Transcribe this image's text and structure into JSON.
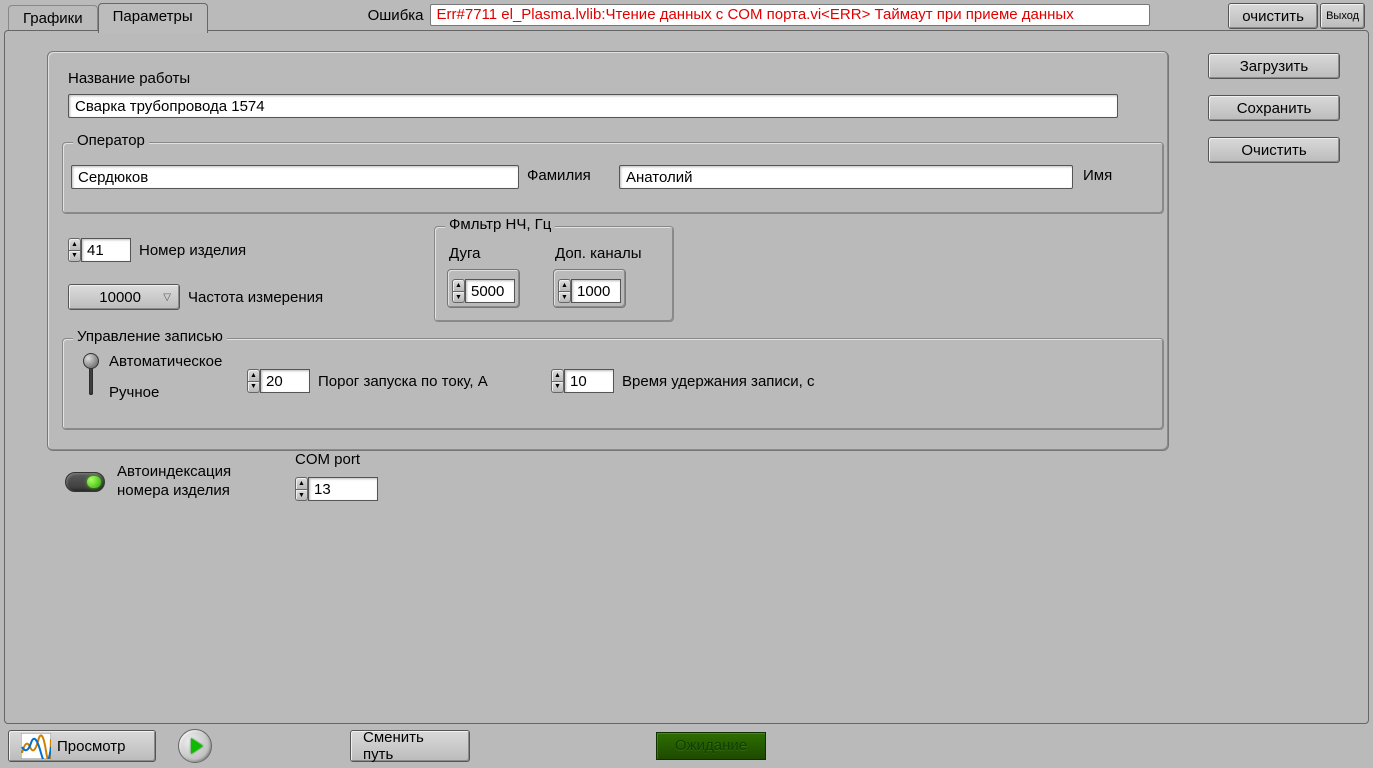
{
  "top": {
    "tab_graphs": "Графики",
    "tab_params": "Параметры",
    "error_label": "Ошибка",
    "error_text": "Err#7711  el_Plasma.lvlib:Чтение данных с COM порта.vi<ERR> Таймаут при приеме данных",
    "btn_clear": "очистить",
    "btn_exit": "Выход"
  },
  "side": {
    "btn_load": "Загрузить",
    "btn_save": "Сохранить",
    "btn_clear": "Очистить"
  },
  "job": {
    "name_label": "Название работы",
    "name_value": "Сварка трубопровода 1574"
  },
  "operator": {
    "legend": "Оператор",
    "lastname_value": "Сердюков",
    "lastname_label": "Фамилия",
    "firstname_value": "Анатолий",
    "firstname_label": "Имя"
  },
  "measure": {
    "product_number": "41",
    "product_number_label": "Номер изделия",
    "frequency": "10000",
    "frequency_label": "Частота измерения"
  },
  "filter": {
    "legend": "Фмльтр НЧ, Гц",
    "arc_label": "Дуга",
    "arc_value": "5000",
    "extra_label": "Доп. каналы",
    "extra_value": "1000"
  },
  "recording": {
    "legend": "Управление записью",
    "auto_label": "Автоматическое",
    "manual_label": "Ручное",
    "threshold_value": "20",
    "threshold_label": "Порог запуска по току, А",
    "hold_value": "10",
    "hold_label": "Время удержания записи, с"
  },
  "misc": {
    "autoindex_label_1": "Автоиндексация",
    "autoindex_label_2": "номера изделия",
    "com_label": "COM port",
    "com_value": "13"
  },
  "footer": {
    "view": "Просмотр",
    "change_path": "Сменить путь",
    "status": "Ожидание"
  }
}
